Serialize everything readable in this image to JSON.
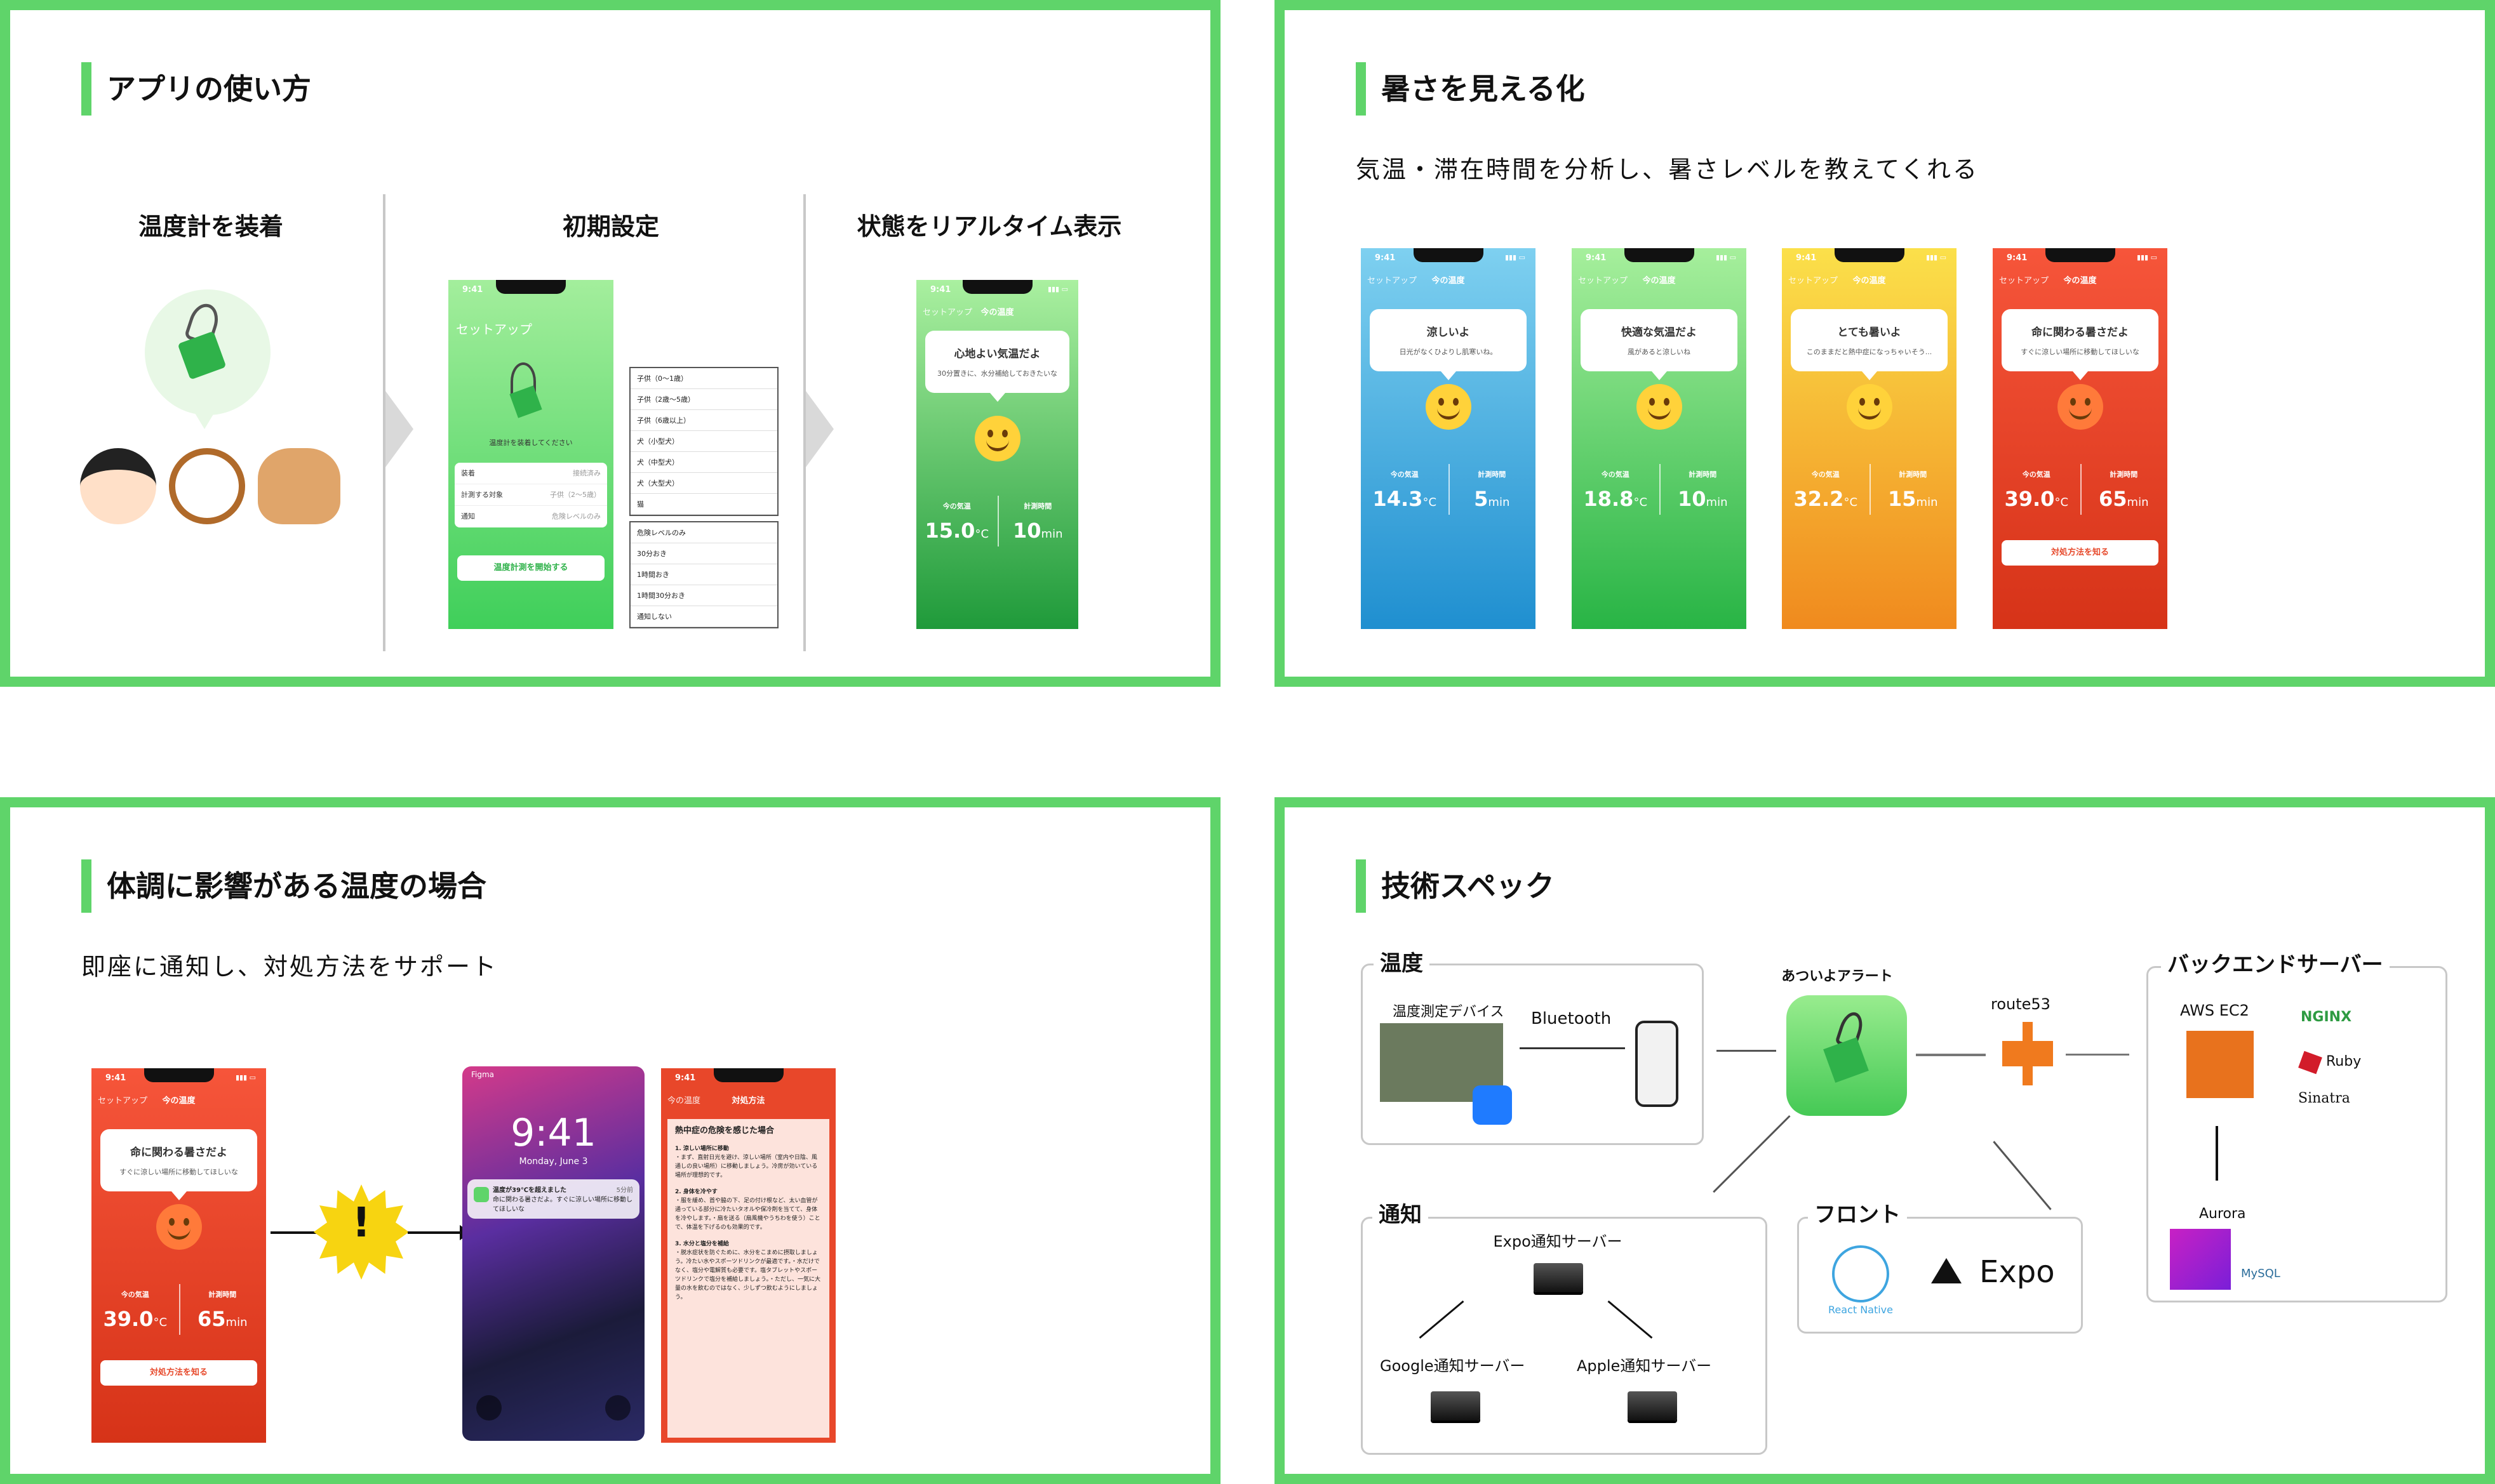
{
  "colors": {
    "accent": "#5fd46a",
    "blue": "#3fa9e6",
    "green": "#49c85b",
    "yellow": "#f5b31f",
    "red": "#e84427"
  },
  "p1": {
    "title": "アプリの使い方",
    "steps": [
      "温度計を装着",
      "初期設定",
      "状態をリアルタイム表示"
    ],
    "setup": {
      "time": "9:41",
      "nav": "セットアップ",
      "title": "セットアップ",
      "caption": "温度計を装着してください",
      "rows": [
        {
          "k": "装着",
          "v": "接続済み"
        },
        {
          "k": "計測する対象",
          "v": "子供（2〜5歳）"
        },
        {
          "k": "通知",
          "v": "危険レベルのみ"
        }
      ],
      "button": "温度計測を開始する"
    },
    "dd1": [
      "子供（0〜1歳）",
      "子供（2歳〜5歳）",
      "子供（6歳以上）",
      "犬（小型犬）",
      "犬（中型犬）",
      "犬（大型犬）",
      "猫"
    ],
    "dd2": [
      "危険レベルのみ",
      "30分おき",
      "1時間おき",
      "1時間30分おき",
      "通知しない"
    ],
    "live": {
      "time": "9:41",
      "nav": "セットアップ",
      "navt": "今の温度",
      "b1": "心地よい気温だよ",
      "b2": "30分置きに、水分補給しておきたいな",
      "l1": "今の気温",
      "v1": "15.0",
      "u1": "°C",
      "l2": "計測時間",
      "v2": "10",
      "u2": "min"
    }
  },
  "p2": {
    "title": "暑さを見える化",
    "subtitle": "気温・滞在時間を分析し、暑さレベルを教えてくれる",
    "phones": [
      {
        "time": "9:41",
        "nav": "セットアップ",
        "navt": "今の温度",
        "b1": "涼しいよ",
        "b2": "日光がなくひよりし肌寒いね。",
        "l1": "今の気温",
        "v1": "14.3",
        "u1": "°C",
        "l2": "計測時間",
        "v2": "5",
        "u2": "min"
      },
      {
        "time": "9:41",
        "nav": "セットアップ",
        "navt": "今の温度",
        "b1": "快適な気温だよ",
        "b2": "風があると涼しいね",
        "l1": "今の気温",
        "v1": "18.8",
        "u1": "°C",
        "l2": "計測時間",
        "v2": "10",
        "u2": "min"
      },
      {
        "time": "9:41",
        "nav": "セットアップ",
        "navt": "今の温度",
        "b1": "とても暑いよ",
        "b2": "このままだと熱中症になっちゃいそう...",
        "l1": "今の気温",
        "v1": "32.2",
        "u1": "°C",
        "l2": "計測時間",
        "v2": "15",
        "u2": "min"
      },
      {
        "time": "9:41",
        "nav": "セットアップ",
        "navt": "今の温度",
        "b1": "命に関わる暑さだよ",
        "b2": "すぐに涼しい場所に移動してほしいな",
        "l1": "今の気温",
        "v1": "39.0",
        "u1": "°C",
        "l2": "計測時間",
        "v2": "65",
        "u2": "min",
        "btn": "対処方法を知る"
      }
    ]
  },
  "p3": {
    "title": "体調に影響がある温度の場合",
    "subtitle": "即座に通知し、対処方法をサポート",
    "alert": {
      "time": "9:41",
      "nav": "セットアップ",
      "navt": "今の温度",
      "b1": "命に関わる暑さだよ",
      "b2": "すぐに涼しい場所に移動してほしいな",
      "l1": "今の気温",
      "v1": "39.0",
      "u1": "°C",
      "l2": "計測時間",
      "v2": "65",
      "u2": "min",
      "btn": "対処方法を知る"
    },
    "warn": "!",
    "lock": {
      "carrier": "Figma",
      "time": "9:41",
      "date": "Monday, June 3",
      "notif_title": "温度が39℃を超えました",
      "notif_body": "命に関わる暑さだよ。すぐに涼しい場所に移動してほしいな",
      "notif_when": "5分前"
    },
    "guide": {
      "time": "9:41",
      "nav": "今の温度",
      "navt": "対処方法",
      "heading": "熱中症の危険を感じた場合",
      "s1": "1. 涼しい場所に移動",
      "s1b": "・まず、直射日光を避け、涼しい場所（室内や日陰、風通しの良い場所）に移動しましょう。冷房が効いている場所が理想的です。",
      "s2": "2. 身体を冷やす",
      "s2b": "・服を緩め、首や脇の下、足の付け根など、太い血管が通っている部分に冷たいタオルや保冷剤を当てて、身体を冷やします。・扇を送る（扇風機やうちわを使う）ことで、体温を下げるのも効果的です。",
      "s3": "3. 水分と塩分を補給",
      "s3b": "・脱水症状を防ぐために、水分をこまめに摂取しましょう。冷たい水やスポーツドリンクが最適です。・水だけでなく、塩分や電解質も必要です。塩タブレットやスポーツドリンクで塩分を補給しましょう。・ただし、一気に大量の水を飲むのではなく、少しずつ飲むようにしましょう。"
    }
  },
  "p4": {
    "title": "技術スペック",
    "temp": {
      "label": "温度",
      "device": "温度測定デバイス",
      "bt": "Bluetooth"
    },
    "app": {
      "name": "あついよアラート"
    },
    "route": "route53",
    "backend": {
      "label": "バックエンドサーバー",
      "ec2": "AWS EC2",
      "nginx": "NGINX",
      "ruby": "Ruby",
      "sinatra": "Sinatra",
      "aurora": "Aurora",
      "mysql": "MySQL"
    },
    "notify": {
      "label": "通知",
      "expo": "Expo通知サーバー",
      "google": "Google通知サーバー",
      "apple": "Apple通知サーバー"
    },
    "front": {
      "label": "フロント",
      "rn": "React Native",
      "expo": "Expo"
    }
  }
}
